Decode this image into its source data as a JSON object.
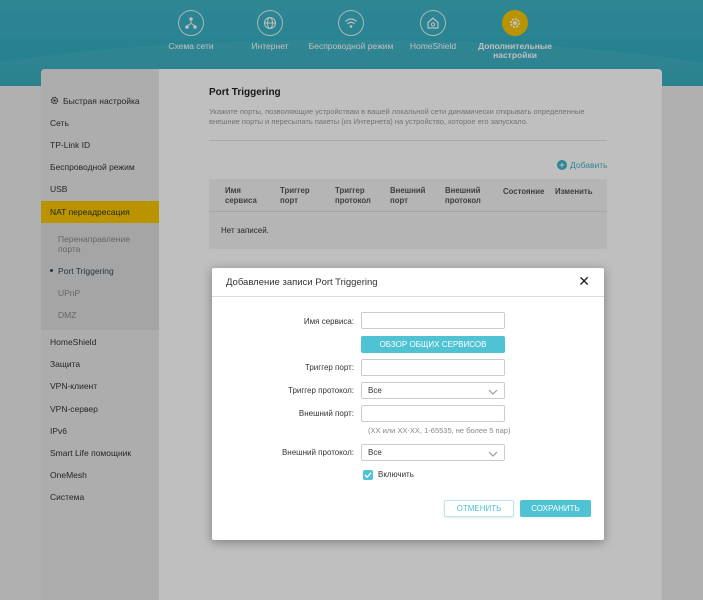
{
  "nav": {
    "items": [
      {
        "label": "Схема сети",
        "icon": "network-map-icon"
      },
      {
        "label": "Интернет",
        "icon": "globe-icon"
      },
      {
        "label": "Беспроводной режим",
        "icon": "wifi-icon"
      },
      {
        "label": "HomeShield",
        "icon": "home-shield-icon"
      },
      {
        "label": "Дополнительные настройки",
        "icon": "gear-icon",
        "active": true
      }
    ]
  },
  "sidebar": {
    "items": [
      {
        "label": "Быстрая настройка"
      },
      {
        "label": "Сеть"
      },
      {
        "label": "TP-Link ID"
      },
      {
        "label": "Беспроводной режим"
      },
      {
        "label": "USB"
      },
      {
        "label": "NAT переадресация",
        "active": true
      },
      {
        "label": "HomeShield"
      },
      {
        "label": "Защита"
      },
      {
        "label": "VPN-клиент"
      },
      {
        "label": "VPN-сервер"
      },
      {
        "label": "IPv6"
      },
      {
        "label": "Smart Life помощник"
      },
      {
        "label": "OneMesh"
      },
      {
        "label": "Система"
      }
    ],
    "subitems": [
      {
        "label": "Перенаправление порта"
      },
      {
        "label": "Port Triggering",
        "active": true
      },
      {
        "label": "UPnP"
      },
      {
        "label": "DMZ"
      }
    ]
  },
  "main": {
    "title": "Port Triggering",
    "description": "Укажите порты, позволяющие устройствам в вашей локальной сети динамически открывать определенные внешние порты и пересылать пакеты (из Интернета) на устройство, которое его запускало.",
    "add_label": "Добавить",
    "table": {
      "headers": [
        "Имя сервиса",
        "Триггер порт",
        "Триггер протокол",
        "Внешний порт",
        "Внешний протокол",
        "Состояние",
        "Изменить"
      ],
      "empty_text": "Нет записей."
    }
  },
  "modal": {
    "title": "Добавление записи Port Triggering",
    "service_name_label": "Имя сервиса:",
    "service_name_value": "",
    "browse_button": "ОБЗОР ОБЩИХ СЕРВИСОВ",
    "trigger_port_label": "Триггер порт:",
    "trigger_port_value": "",
    "trigger_protocol_label": "Триггер протокол:",
    "trigger_protocol_value": "Все",
    "external_port_label": "Внешний порт:",
    "external_port_value": "",
    "external_port_hint": "(XX или XX-XX, 1-65535, не более 5 пар)",
    "external_protocol_label": "Внешний протокол:",
    "external_protocol_value": "Все",
    "enable_label": "Включить",
    "enable_checked": true,
    "cancel_button": "ОТМЕНИТЬ",
    "save_button": "СОХРАНИТЬ"
  },
  "colors": {
    "accent": "#4fc2d3",
    "active_nav": "#f7c500",
    "banner": "#3fb4c6"
  }
}
